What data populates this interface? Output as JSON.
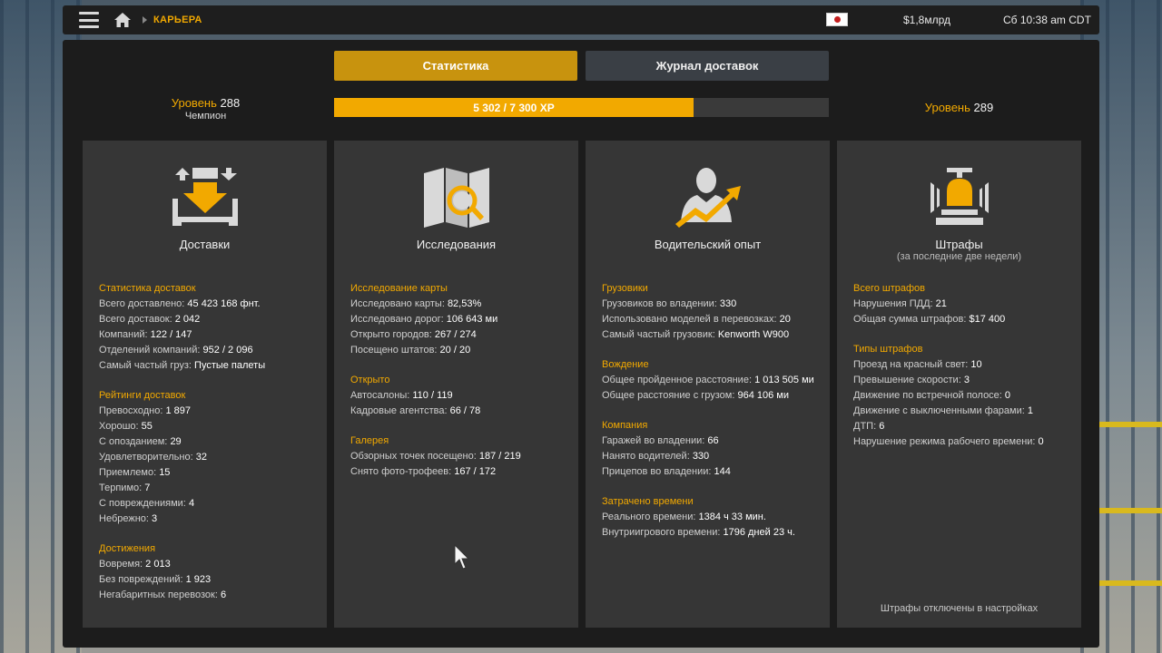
{
  "topbar": {
    "breadcrumb": "КАРЬЕРА",
    "money": "$1,8млрд",
    "clock": "Сб 10:38 am CDT"
  },
  "tabs": {
    "stats": "Статистика",
    "log": "Журнал доставок"
  },
  "level": {
    "word": "Уровень",
    "current": "288",
    "rank": "Чемпион",
    "next": "289",
    "xp_text": "5 302 / 7 300 XP",
    "xp_fraction": 0.7263
  },
  "colors": {
    "accent": "#f2a900",
    "panel": "#1c1c1c",
    "card": "#363636"
  },
  "cards": [
    {
      "icon": "delivery-icon",
      "title": "Доставки",
      "subtitle": "",
      "sections": [
        {
          "header": "Статистика доставок",
          "rows": [
            {
              "label": "Всего доставлено:",
              "value": "45 423 168 фнт."
            },
            {
              "label": "Всего доставок:",
              "value": "2 042"
            },
            {
              "label": "Компаний:",
              "value": "122 / 147"
            },
            {
              "label": "Отделений компаний:",
              "value": "952 / 2 096"
            },
            {
              "label": "Самый частый груз:",
              "value": "Пустые палеты"
            }
          ]
        },
        {
          "header": "Рейтинги доставок",
          "rows": [
            {
              "label": "Превосходно:",
              "value": "1 897"
            },
            {
              "label": "Хорошо:",
              "value": "55"
            },
            {
              "label": "С опозданием:",
              "value": "29"
            },
            {
              "label": "Удовлетворительно:",
              "value": "32"
            },
            {
              "label": "Приемлемо:",
              "value": "15"
            },
            {
              "label": "Терпимо:",
              "value": "7"
            },
            {
              "label": "С повреждениями:",
              "value": "4"
            },
            {
              "label": "Небрежно:",
              "value": "3"
            }
          ]
        },
        {
          "header": "Достижения",
          "rows": [
            {
              "label": "Вовремя:",
              "value": "2 013"
            },
            {
              "label": "Без повреждений:",
              "value": "1 923"
            },
            {
              "label": "Негабаритных перевозок:",
              "value": "6"
            }
          ]
        }
      ],
      "footer": ""
    },
    {
      "icon": "map-search-icon",
      "title": "Исследования",
      "subtitle": "",
      "sections": [
        {
          "header": "Исследование карты",
          "rows": [
            {
              "label": "Исследовано карты:",
              "value": "82,53%"
            },
            {
              "label": "Исследовано дорог:",
              "value": "106 643 ми"
            },
            {
              "label": "Открыто городов:",
              "value": "267 / 274"
            },
            {
              "label": "Посещено штатов:",
              "value": "20 / 20"
            }
          ]
        },
        {
          "header": "Открыто",
          "rows": [
            {
              "label": "Автосалоны:",
              "value": "110 / 119"
            },
            {
              "label": "Кадровые агентства:",
              "value": "66 / 78"
            }
          ]
        },
        {
          "header": "Галерея",
          "rows": [
            {
              "label": "Обзорных точек посещено:",
              "value": "187 / 219"
            },
            {
              "label": "Снято фото-трофеев:",
              "value": "167 / 172"
            }
          ]
        }
      ],
      "footer": ""
    },
    {
      "icon": "driver-growth-icon",
      "title": "Водительский опыт",
      "subtitle": "",
      "sections": [
        {
          "header": "Грузовики",
          "rows": [
            {
              "label": "Грузовиков во владении:",
              "value": "330"
            },
            {
              "label": "Использовано моделей в перевозках:",
              "value": "20"
            },
            {
              "label": "Самый частый грузовик:",
              "value": "Kenworth W900"
            }
          ]
        },
        {
          "header": "Вождение",
          "rows": [
            {
              "label": "Общее пройденное расстояние:",
              "value": "1 013 505 ми"
            },
            {
              "label": "Общее расстояние с грузом:",
              "value": "964 106 ми"
            }
          ]
        },
        {
          "header": "Компания",
          "rows": [
            {
              "label": "Гаражей во владении:",
              "value": "66"
            },
            {
              "label": "Нанято водителей:",
              "value": "330"
            },
            {
              "label": "Прицепов во владении:",
              "value": "144"
            }
          ]
        },
        {
          "header": "Затрачено времени",
          "rows": [
            {
              "label": "Реального времени:",
              "value": "1384 ч 33 мин."
            },
            {
              "label": "Внутриигрового времени:",
              "value": "1796 дней 23 ч."
            }
          ]
        }
      ],
      "footer": ""
    },
    {
      "icon": "police-siren-icon",
      "title": "Штрафы",
      "subtitle": "(за последние две недели)",
      "sections": [
        {
          "header": "Всего штрафов",
          "rows": [
            {
              "label": "Нарушения ПДД:",
              "value": "21"
            },
            {
              "label": "Общая сумма штрафов:",
              "value": "$17 400"
            }
          ]
        },
        {
          "header": "Типы штрафов",
          "rows": [
            {
              "label": "Проезд на красный свет:",
              "value": "10"
            },
            {
              "label": "Превышение скорости:",
              "value": "3"
            },
            {
              "label": "Движение по встречной полосе:",
              "value": "0"
            },
            {
              "label": "Движение с выключенными фарами:",
              "value": "1"
            },
            {
              "label": "ДТП:",
              "value": "6"
            },
            {
              "label": "Нарушение режима рабочего времени:",
              "value": "0"
            }
          ]
        }
      ],
      "footer": "Штрафы отключены в настройках"
    }
  ]
}
